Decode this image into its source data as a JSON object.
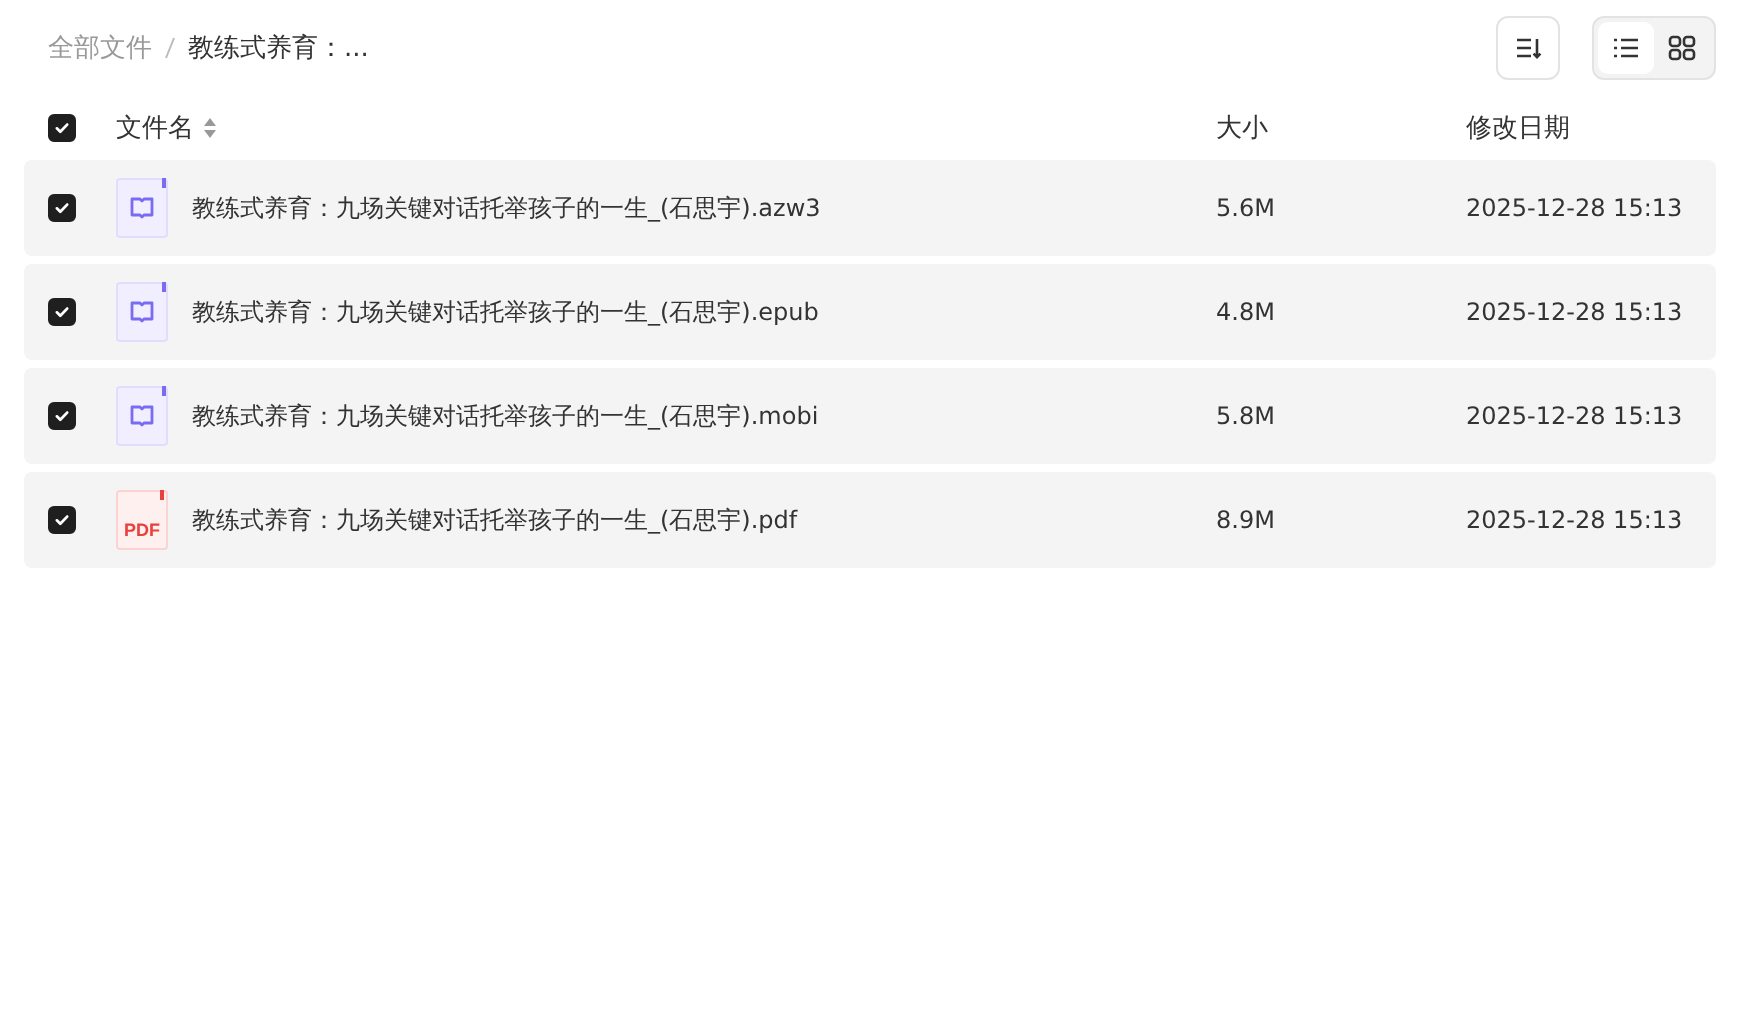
{
  "breadcrumb": [
    {
      "label": "全部文件",
      "current": false
    },
    {
      "label": "教练式养育：...",
      "current": true
    }
  ],
  "toolbar": {
    "view_modes": [
      {
        "kind": "list",
        "selected": true
      },
      {
        "kind": "grid",
        "selected": false
      }
    ]
  },
  "table": {
    "select_all": {
      "checked": true
    },
    "columns": [
      "文件名",
      "大小",
      "修改日期"
    ],
    "rows": [
      {
        "checked": true,
        "kind": "ebook",
        "name": "教练式养育：九场关键对话托举孩子的一生_(石思宇).azw3",
        "size": "5.6M",
        "modified": "2025-12-28 15:13"
      },
      {
        "checked": true,
        "kind": "ebook",
        "name": "教练式养育：九场关键对话托举孩子的一生_(石思宇).epub",
        "size": "4.8M",
        "modified": "2025-12-28 15:13"
      },
      {
        "checked": true,
        "kind": "ebook",
        "name": "教练式养育：九场关键对话托举孩子的一生_(石思宇).mobi",
        "size": "5.8M",
        "modified": "2025-12-28 15:13"
      },
      {
        "checked": true,
        "kind": "pdf",
        "icon_label": "PDF",
        "name": "教练式养育：九场关键对话托举孩子的一生_(石思宇).pdf",
        "size": "8.9M",
        "modified": "2025-12-28 15:13"
      }
    ]
  }
}
